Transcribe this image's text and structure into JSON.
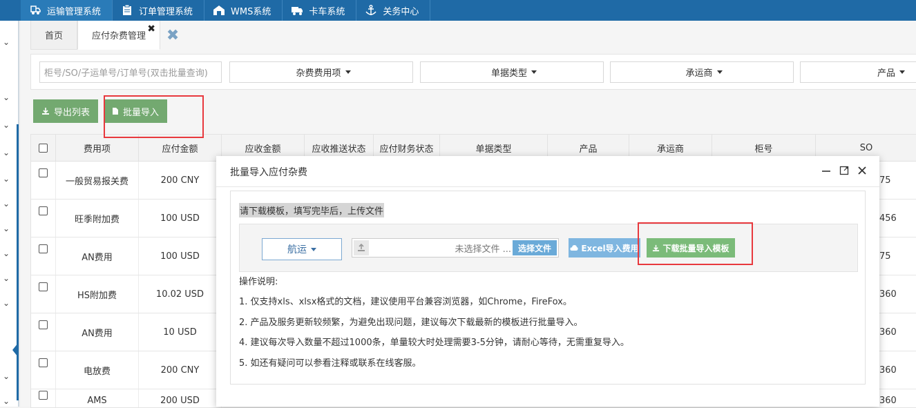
{
  "topnav": [
    {
      "label": "运输管理系统",
      "icon": "truck-badge-icon"
    },
    {
      "label": "订单管理系统",
      "icon": "clipboard-icon"
    },
    {
      "label": "WMS系统",
      "icon": "warehouse-icon"
    },
    {
      "label": "卡车系统",
      "icon": "truck-icon"
    },
    {
      "label": "关务中心",
      "icon": "anchor-icon"
    }
  ],
  "tabs": {
    "home": "首页",
    "current": "应付杂费管理",
    "current_close": "✖"
  },
  "filters": {
    "search_placeholder": "柜号/SO/子运单号/订单号(双击批量查询)",
    "fee_item": "杂费费用项",
    "doc_type": "单据类型",
    "carrier": "承运商",
    "product": "产品"
  },
  "toolbar": {
    "export": "导出列表",
    "batch_import": "批量导入"
  },
  "table": {
    "headers": [
      "费用项",
      "应付金额",
      "应收金额",
      "应收推送状态",
      "应付财务状态",
      "单据类型",
      "产品",
      "承运商",
      "柜号",
      "SO"
    ],
    "rows": [
      {
        "fee": "一般贸易报关费",
        "amount": "200 CNY",
        "so": "75"
      },
      {
        "fee": "旺季附加费",
        "amount": "100 USD",
        "so": "456"
      },
      {
        "fee": "AN费用",
        "amount": "100 USD",
        "so": "75"
      },
      {
        "fee": "HS附加费",
        "amount": "10.02 USD",
        "so": "360"
      },
      {
        "fee": "AN费用",
        "amount": "10 USD",
        "so": "360"
      },
      {
        "fee": "电放费",
        "amount": "200 CNY",
        "so": "360"
      },
      {
        "fee": "AMS",
        "amount": "200 USD",
        "so": "360"
      }
    ]
  },
  "modal": {
    "title": "批量导入应付杂费",
    "hint": "请下载模板，填写完毕后，上传文件",
    "mode": "航运",
    "file_placeholder": "未选择文件 ...",
    "choose_file": "选择文件",
    "excel_import": "Excel导入费用",
    "download_template": "下载批量导入模板",
    "instructions_title": "操作说明:",
    "instructions": [
      "1. 仅支持xls、xlsx格式的文档，建议使用平台兼容浏览器，如Chrome，FireFox。",
      "2. 产品及服务更新较频繁，为避免出现问题，建议每次下载最新的模板进行批量导入。",
      "4. 建议每次导入数量不超过1000条，单量较大时处理需要3-5分钟，请耐心等待，无需重复导入。",
      "5. 如还有疑问可以参看注释或联系在线客服。"
    ]
  },
  "colors": {
    "topbar": "#1f6aa6",
    "green_button": "#5d9c59",
    "highlight_box": "#e8383d",
    "choose_button": "#6aaad8",
    "excel_button": "#7fb6e0",
    "download_button": "#7bbb79"
  }
}
